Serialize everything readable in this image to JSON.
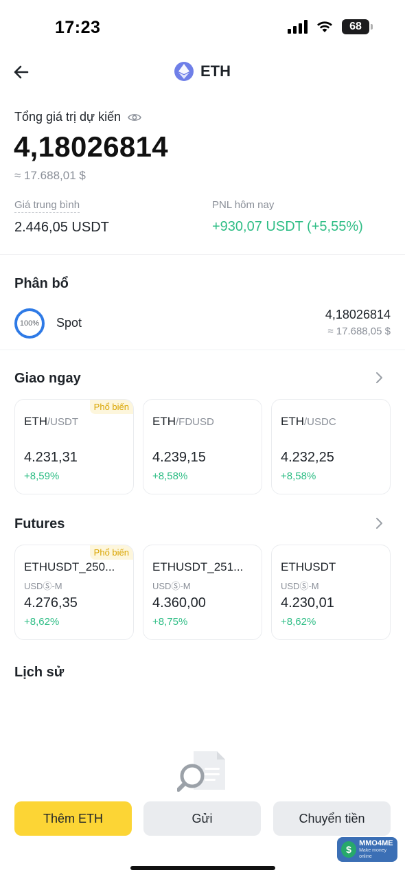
{
  "status_bar": {
    "time": "17:23",
    "battery": "68"
  },
  "header": {
    "title": "ETH",
    "back_icon": "arrow-left-icon",
    "coin_icon": "ethereum-logo-icon"
  },
  "balance": {
    "label": "Tổng giá trị dự kiến",
    "amount": "4,18026814",
    "fiat": "≈ 17.688,01 $"
  },
  "stats": {
    "avg_price_label": "Giá trung bình",
    "avg_price_value": "2.446,05 USDT",
    "pnl_label": "PNL hôm nay",
    "pnl_value": "+930,07 USDT (+5,55%)"
  },
  "allocation": {
    "title": "Phân bổ",
    "items": [
      {
        "percent": "100%",
        "name": "Spot",
        "amount": "4,18026814",
        "fiat": "≈ 17.688,05 $"
      }
    ]
  },
  "spot": {
    "title": "Giao ngay",
    "cards": [
      {
        "base": "ETH",
        "quote": "/USDT",
        "badge": "Phổ biến",
        "price": "4.231,31",
        "change": "+8,59%"
      },
      {
        "base": "ETH",
        "quote": "/FDUSD",
        "badge": "",
        "price": "4.239,15",
        "change": "+8,58%"
      },
      {
        "base": "ETH",
        "quote": "/USDC",
        "badge": "",
        "price": "4.232,25",
        "change": "+8,58%"
      }
    ]
  },
  "futures": {
    "title": "Futures",
    "cards": [
      {
        "symbol": "ETHUSDT_250...",
        "type": "USDⓈ-M",
        "badge": "Phổ biến",
        "price": "4.276,35",
        "change": "+8,62%"
      },
      {
        "symbol": "ETHUSDT_251...",
        "type": "USDⓈ-M",
        "badge": "",
        "price": "4.360,00",
        "change": "+8,75%"
      },
      {
        "symbol": "ETHUSDT",
        "type": "USDⓈ-M",
        "badge": "",
        "price": "4.230,01",
        "change": "+8,62%"
      }
    ]
  },
  "history": {
    "title": "Lịch sử"
  },
  "actions": {
    "buy": "Thêm ETH",
    "send": "Gửi",
    "transfer": "Chuyển tiền"
  },
  "watermark": {
    "text": "MMO4ME",
    "sub": "Make money online",
    "coin": "$"
  },
  "colors": {
    "accent": "#fcd535",
    "positive": "#2ebd85",
    "ring": "#2e7ae6",
    "eth": "#6f7fe8"
  }
}
